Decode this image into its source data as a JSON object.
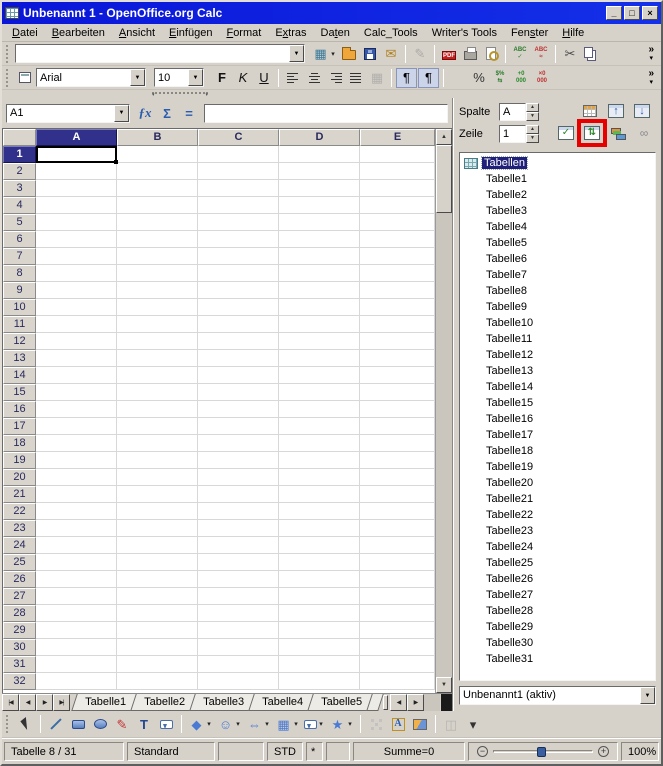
{
  "colors": {
    "titlebar_blue": "#0a16d8",
    "selection_navy": "#31318c",
    "annotation_red": "#e80000",
    "icon_blue": "#3a6ea5"
  },
  "window": {
    "title": "Unbenannt 1 - OpenOffice.org Calc",
    "controls": [
      {
        "name": "minimize",
        "glyph": "_"
      },
      {
        "name": "maximize",
        "glyph": "□"
      },
      {
        "name": "close",
        "glyph": "×"
      }
    ]
  },
  "menu": {
    "items": [
      {
        "label": "Datei",
        "accel": 0
      },
      {
        "label": "Bearbeiten",
        "accel": 0
      },
      {
        "label": "Ansicht",
        "accel": 0
      },
      {
        "label": "Einfügen",
        "accel": 0
      },
      {
        "label": "Format",
        "accel": 0
      },
      {
        "label": "Extras",
        "accel": 1
      },
      {
        "label": "Daten",
        "accel": 2
      },
      {
        "label": "Calc_Tools",
        "accel": -1
      },
      {
        "label": "Writer's Tools",
        "accel": -1
      },
      {
        "label": "Fenster",
        "accel": 3
      },
      {
        "label": "Hilfe",
        "accel": 0
      }
    ]
  },
  "toolbar_standard": {
    "url_value": "",
    "buttons": [
      {
        "name": "new-spreadsheet",
        "glyph": "▦",
        "color": "#3a7a9a",
        "dropdown": true
      },
      {
        "name": "open"
      },
      {
        "name": "save"
      },
      {
        "name": "send-email",
        "glyph": "✉",
        "color": "#b08020"
      },
      {
        "sep": true
      },
      {
        "name": "edit-file",
        "glyph": "✎",
        "color": "#777777",
        "disabled": true
      },
      {
        "sep": true
      },
      {
        "name": "export-pdf",
        "glyph": "PDF",
        "micro": true
      },
      {
        "name": "print"
      },
      {
        "name": "page-preview"
      },
      {
        "sep": true
      },
      {
        "name": "spellcheck",
        "stack": [
          "ABC",
          "✓"
        ],
        "color": "#2a7a2a"
      },
      {
        "name": "autospellcheck",
        "stack": [
          "ABC",
          "≈"
        ],
        "color": "#c03030"
      },
      {
        "sep": true
      },
      {
        "name": "cut",
        "glyph": "✂",
        "color": "#4a4a4a"
      },
      {
        "name": "copy"
      }
    ],
    "overflow": {
      "chevron": "»",
      "arrow": "▾"
    }
  },
  "toolbar_formatting": {
    "font_name": "Arial",
    "font_size": "10",
    "buttons": [
      {
        "name": "bold",
        "glyph": "F",
        "color": "#111111",
        "weight": "bold"
      },
      {
        "name": "italic",
        "glyph": "K",
        "color": "#111111",
        "italic": true
      },
      {
        "name": "underline",
        "glyph": "U",
        "color": "#111111",
        "underline": true
      },
      {
        "sep": true
      },
      {
        "name": "align-left",
        "bars": [
          11,
          7,
          11,
          7
        ]
      },
      {
        "name": "align-center",
        "bars": [
          7,
          11,
          7,
          11
        ]
      },
      {
        "name": "align-right",
        "bars": [
          11,
          7,
          11,
          7
        ]
      },
      {
        "name": "align-justified",
        "bars": [
          11,
          11,
          11,
          11
        ]
      },
      {
        "name": "merge-cells",
        "glyph": "▦",
        "color": "#888888",
        "disabled": true
      },
      {
        "sep": true
      },
      {
        "name": "left-to-right",
        "glyph": "¶",
        "pressed": true
      },
      {
        "name": "right-to-left",
        "glyph": "¶",
        "pressed": true
      },
      {
        "sep": true
      },
      {
        "name": "currency-format"
      },
      {
        "name": "percent-format",
        "glyph": "%",
        "color": "#333333"
      },
      {
        "name": "standard-format",
        "stack": [
          "$%",
          "⇆"
        ],
        "color": "#2a7a2a"
      },
      {
        "name": "add-decimal",
        "stack": [
          "+0",
          "000"
        ],
        "color": "#2a8a2a"
      },
      {
        "name": "delete-decimal",
        "stack": [
          "×0",
          "000"
        ],
        "color": "#c03030"
      }
    ],
    "overflow": {
      "chevron": "»",
      "arrow": "▾"
    }
  },
  "formula_bar": {
    "cell_reference": "A1",
    "input_value": "",
    "buttons": [
      {
        "name": "function-wizard",
        "glyph": "ƒx"
      },
      {
        "name": "sum",
        "glyph": "Σ"
      },
      {
        "name": "function",
        "glyph": "="
      }
    ]
  },
  "grid": {
    "columns": [
      "A",
      "B",
      "C",
      "D",
      "E"
    ],
    "row_numbers": [
      1,
      2,
      3,
      4,
      5,
      6,
      7,
      8,
      9,
      10,
      11,
      12,
      13,
      14,
      15,
      16,
      17,
      18,
      19,
      20,
      21,
      22,
      23,
      24,
      25,
      26,
      27,
      28,
      29,
      30,
      31,
      32
    ],
    "selected_column": "A",
    "selected_row": 1,
    "selected_cell": "A1"
  },
  "navigator": {
    "column_label": "Spalte",
    "column_value": "A",
    "row_label": "Zeile",
    "row_value": "1",
    "buttons_row1": [
      {
        "name": "data-range"
      },
      {
        "name": "start",
        "glyph": "↑",
        "color": "#2a5db0"
      },
      {
        "name": "end",
        "glyph": "↓",
        "color": "#2a5db0"
      }
    ],
    "buttons_row2": [
      {
        "name": "contents",
        "glyph": "✓",
        "color": "#2a8a2a"
      },
      {
        "name": "toggle",
        "glyph": "⇅",
        "color": "#2a8a2a",
        "highlighted": true
      },
      {
        "name": "scenarios"
      },
      {
        "name": "drag-mode",
        "glyph": "∞",
        "color": "#8a8a8a"
      }
    ],
    "root_label": "Tabellen",
    "sheets": [
      "Tabelle1",
      "Tabelle2",
      "Tabelle3",
      "Tabelle4",
      "Tabelle5",
      "Tabelle6",
      "Tabelle7",
      "Tabelle8",
      "Tabelle9",
      "Tabelle10",
      "Tabelle11",
      "Tabelle12",
      "Tabelle13",
      "Tabelle14",
      "Tabelle15",
      "Tabelle16",
      "Tabelle17",
      "Tabelle18",
      "Tabelle19",
      "Tabelle20",
      "Tabelle21",
      "Tabelle22",
      "Tabelle23",
      "Tabelle24",
      "Tabelle25",
      "Tabelle26",
      "Tabelle27",
      "Tabelle28",
      "Tabelle29",
      "Tabelle30",
      "Tabelle31"
    ],
    "document": "Unbenannt1 (aktiv)"
  },
  "sheet_tabs": {
    "nav_buttons": [
      {
        "name": "first-sheet",
        "glyph": "|◀"
      },
      {
        "name": "previous-sheet",
        "glyph": "◀"
      },
      {
        "name": "next-sheet",
        "glyph": "▶"
      },
      {
        "name": "last-sheet",
        "glyph": "▶|"
      }
    ],
    "tabs": [
      "Tabelle1",
      "Tabelle2",
      "Tabelle3",
      "Tabelle4",
      "Tabelle5"
    ],
    "scroll_buttons": [
      {
        "name": "scroll-tabs-left",
        "glyph": "◀"
      },
      {
        "name": "scroll-tabs-right",
        "glyph": "▶"
      }
    ]
  },
  "drawing_toolbar": {
    "buttons": [
      {
        "name": "select"
      },
      {
        "sep": true
      },
      {
        "name": "line"
      },
      {
        "name": "rectangle"
      },
      {
        "name": "ellipse"
      },
      {
        "name": "freeform-line",
        "glyph": "✎",
        "color": "#c03030"
      },
      {
        "name": "text",
        "glyph": "T",
        "color": "#26468e",
        "weight": "bold"
      },
      {
        "name": "callout"
      },
      {
        "sep": true
      },
      {
        "name": "basic-shapes",
        "glyph": "◆",
        "color": "#4a7ad4",
        "dropdown": true
      },
      {
        "name": "symbol-shapes",
        "glyph": "☺",
        "color": "#4a7ad4",
        "dropdown": true
      },
      {
        "name": "block-arrows",
        "glyph": "⇔",
        "color": "#4a7ad4",
        "dropdown": true
      },
      {
        "name": "flowchart",
        "glyph": "▦",
        "color": "#4a7ad4",
        "dropdown": true
      },
      {
        "name": "callouts",
        "dropdown": true
      },
      {
        "name": "stars",
        "glyph": "★",
        "color": "#4a7ad4",
        "dropdown": true
      },
      {
        "sep": true
      },
      {
        "name": "points",
        "disabled": true
      },
      {
        "name": "fontwork",
        "glyph": "A"
      },
      {
        "name": "from-file"
      },
      {
        "sep": true
      },
      {
        "name": "extrusion",
        "glyph": "◫",
        "color": "#909090",
        "disabled": true
      },
      {
        "name": "toolbar-options",
        "glyph": "▾",
        "color": "#333333"
      }
    ]
  },
  "status_bar": {
    "sheet_position": "Tabelle 8 / 31",
    "page_style": "Standard",
    "selection_mode": "STD",
    "modified_flag": "*",
    "sum": "Summe=0",
    "zoom_out": "−",
    "zoom_in": "+",
    "zoom_percent": "100%"
  }
}
